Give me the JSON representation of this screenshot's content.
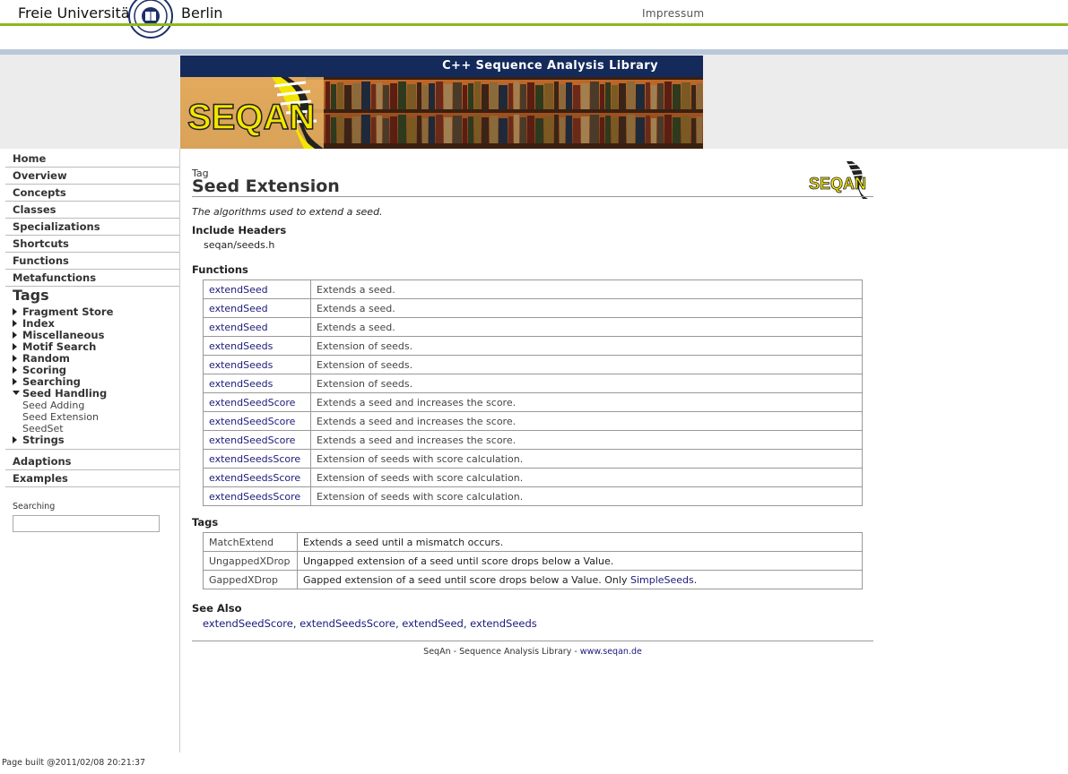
{
  "top": {
    "university_left": "Freie Universität",
    "university_right": "Berlin",
    "impressum": "Impressum"
  },
  "banner": {
    "title": "C++ Sequence Analysis Library",
    "logo_text": "SEQAN"
  },
  "sidebar": {
    "nav": [
      {
        "label": "Home"
      },
      {
        "label": "Overview"
      },
      {
        "label": "Concepts"
      },
      {
        "label": "Classes"
      },
      {
        "label": "Specializations"
      },
      {
        "label": "Shortcuts"
      },
      {
        "label": "Functions"
      },
      {
        "label": "Metafunctions"
      }
    ],
    "tags_heading": "Tags",
    "tag_groups": [
      {
        "label": "Fragment Store",
        "expanded": false
      },
      {
        "label": "Index",
        "expanded": false
      },
      {
        "label": "Miscellaneous",
        "expanded": false
      },
      {
        "label": "Motif Search",
        "expanded": false
      },
      {
        "label": "Random",
        "expanded": false
      },
      {
        "label": "Scoring",
        "expanded": false
      },
      {
        "label": "Searching",
        "expanded": false
      },
      {
        "label": "Seed Handling",
        "expanded": true
      },
      {
        "label": "Strings",
        "expanded": false
      }
    ],
    "seed_handling_items": [
      "Seed Adding",
      "Seed Extension",
      "SeedSet"
    ],
    "bottom_nav": [
      {
        "label": "Adaptions"
      },
      {
        "label": "Examples"
      }
    ],
    "search_label": "Searching",
    "search_value": ""
  },
  "main": {
    "kind": "Tag",
    "title": "Seed Extension",
    "summary": "The algorithms used to extend a seed.",
    "include_heading": "Include Headers",
    "include_path": "seqan/seeds.h",
    "functions_heading": "Functions",
    "functions": [
      {
        "name": "extendSeed",
        "desc": "Extends a seed."
      },
      {
        "name": "extendSeed",
        "desc": "Extends a seed."
      },
      {
        "name": "extendSeed",
        "desc": "Extends a seed."
      },
      {
        "name": "extendSeeds",
        "desc": "Extension of seeds."
      },
      {
        "name": "extendSeeds",
        "desc": "Extension of seeds."
      },
      {
        "name": "extendSeeds",
        "desc": "Extension of seeds."
      },
      {
        "name": "extendSeedScore",
        "desc": "Extends a seed and increases the score."
      },
      {
        "name": "extendSeedScore",
        "desc": "Extends a seed and increases the score."
      },
      {
        "name": "extendSeedScore",
        "desc": "Extends a seed and increases the score."
      },
      {
        "name": "extendSeedsScore",
        "desc": "Extension of seeds with score calculation."
      },
      {
        "name": "extendSeedsScore",
        "desc": "Extension of seeds with score calculation."
      },
      {
        "name": "extendSeedsScore",
        "desc": "Extension of seeds with score calculation."
      }
    ],
    "tags_heading": "Tags",
    "tags": [
      {
        "name": "MatchExtend",
        "desc": "Extends a seed until a mismatch occurs."
      },
      {
        "name": "UngappedXDrop",
        "desc": "Ungapped extension of a seed until score drops below a Value."
      },
      {
        "name": "GappedXDrop",
        "desc": "Gapped extension of a seed until score drops below a Value. Only ",
        "link": "SimpleSeeds",
        "suffix": "."
      }
    ],
    "see_also_heading": "See Also",
    "see_also": [
      "extendSeedScore",
      "extendSeedsScore",
      "extendSeed",
      "extendSeeds"
    ],
    "footer_text": "SeqAn - Sequence Analysis Library - ",
    "footer_link": "www.seqan.de"
  },
  "page_built": "Page built @2011/02/08 20:21:37",
  "colors": {
    "accent_green": "#8cb81a",
    "banner_navy": "#132a5a",
    "link": "#1a1a7a",
    "seqan_yellow": "#f2e600"
  }
}
